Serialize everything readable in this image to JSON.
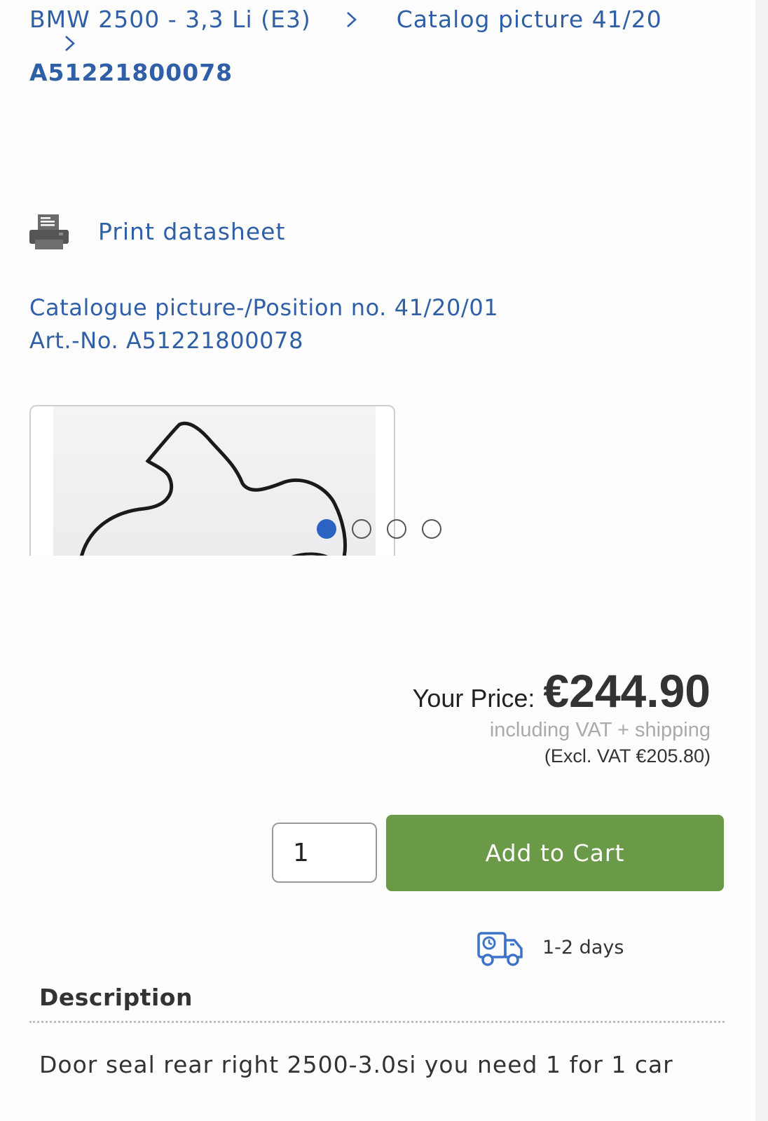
{
  "breadcrumb": {
    "items": [
      "BMW 2500 - 3,3 Li (E3)",
      "Catalog picture 41/20"
    ],
    "current": "A51221800078"
  },
  "print": {
    "label": "Print datasheet",
    "icon": "printer-icon"
  },
  "position": {
    "catalogue": "Catalogue picture-/Position no. 41/20/01",
    "article": "Art.-No. A51221800078"
  },
  "gallery": {
    "slide_count": 4,
    "active_slide": 1
  },
  "price": {
    "label": "Your Price:",
    "value": "€244.90",
    "vat_note": "including VAT + shipping",
    "excl_vat": "(Excl. VAT €205.80)"
  },
  "cart": {
    "quantity": "1",
    "button_label": "Add to Cart"
  },
  "delivery": {
    "text": "1-2 days",
    "icon": "delivery-truck-icon"
  },
  "description": {
    "heading": "Description",
    "text": "Door seal rear right 2500-3.0si you need 1 for 1 car"
  },
  "colors": {
    "link_blue": "#2f5fa6",
    "add_to_cart_green": "#6a9a48",
    "active_dot": "#2a63c1"
  }
}
